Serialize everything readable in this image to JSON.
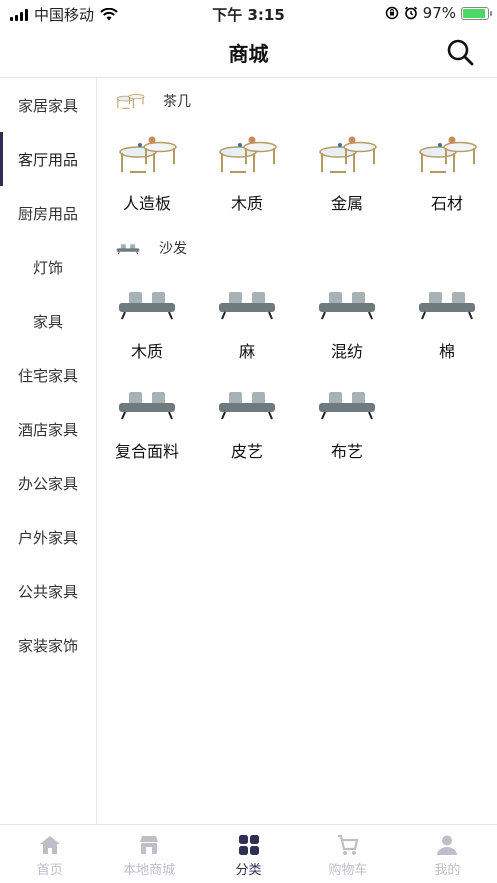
{
  "status_bar": {
    "carrier": "中国移动",
    "time": "下午 3:15",
    "battery": "97%"
  },
  "header": {
    "title": "商城",
    "search_icon": "search-icon"
  },
  "sidebar": {
    "active_index": 1,
    "items": [
      {
        "label": "家居家具"
      },
      {
        "label": "客厅用品"
      },
      {
        "label": "厨房用品"
      },
      {
        "label": "灯饰"
      },
      {
        "label": "家具"
      },
      {
        "label": "住宅家具"
      },
      {
        "label": "酒店家具"
      },
      {
        "label": "办公家具"
      },
      {
        "label": "户外家具"
      },
      {
        "label": "公共家具"
      },
      {
        "label": "家装家饰"
      }
    ]
  },
  "sections": [
    {
      "title": "茶几",
      "icon": "coffee-table-icon",
      "items": [
        {
          "label": "人造板"
        },
        {
          "label": "木质"
        },
        {
          "label": "金属"
        },
        {
          "label": "石材"
        }
      ]
    },
    {
      "title": "沙发",
      "icon": "sofa-icon",
      "items": [
        {
          "label": "木质"
        },
        {
          "label": "麻"
        },
        {
          "label": "混纺"
        },
        {
          "label": "棉"
        },
        {
          "label": "复合面料"
        },
        {
          "label": "皮艺"
        },
        {
          "label": "布艺"
        }
      ]
    }
  ],
  "tab_bar": {
    "active_index": 2,
    "tabs": [
      {
        "label": "首页",
        "icon": "home-icon"
      },
      {
        "label": "本地商城",
        "icon": "store-icon"
      },
      {
        "label": "分类",
        "icon": "category-icon"
      },
      {
        "label": "购物车",
        "icon": "cart-icon"
      },
      {
        "label": "我的",
        "icon": "user-icon"
      }
    ]
  },
  "colors": {
    "accent": "#2f2f55",
    "tab_inactive": "#bfbfca",
    "divider": "#e6e6e6"
  }
}
